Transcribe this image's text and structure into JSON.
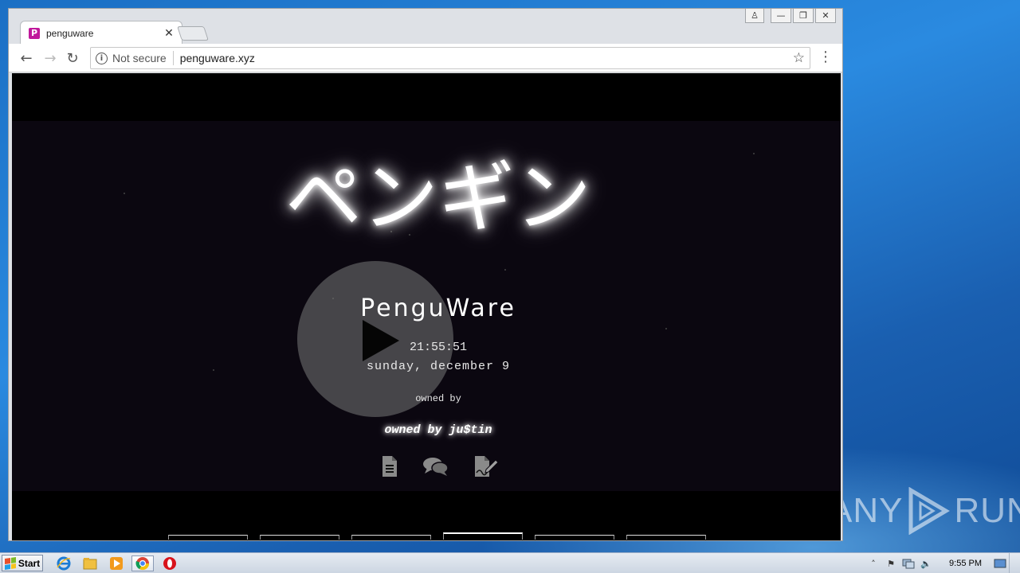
{
  "browser": {
    "tab": {
      "favicon": "P",
      "title": "penguware"
    },
    "address": {
      "security_label": "Not secure",
      "url": "penguware.xyz"
    }
  },
  "page": {
    "katakana_title": "ペンギン",
    "brand": "PenguWare",
    "clock": "21:55:51",
    "date": "sunday, december 9",
    "owned_label": "owned by",
    "owner": "owned by ju$tin",
    "icons": [
      "document-icon",
      "chat-icon",
      "signature-icon"
    ],
    "nav_tab_count": 6,
    "active_nav_tab": 3
  },
  "taskbar": {
    "start_label": "Start",
    "clock": "9:55 PM"
  },
  "watermark": {
    "left": "ANY",
    "right": "RUN"
  },
  "colors": {
    "favicon_bg": "#c0189b",
    "page_bg": "#0b0710",
    "chrome_bg": "#dee1e6"
  }
}
